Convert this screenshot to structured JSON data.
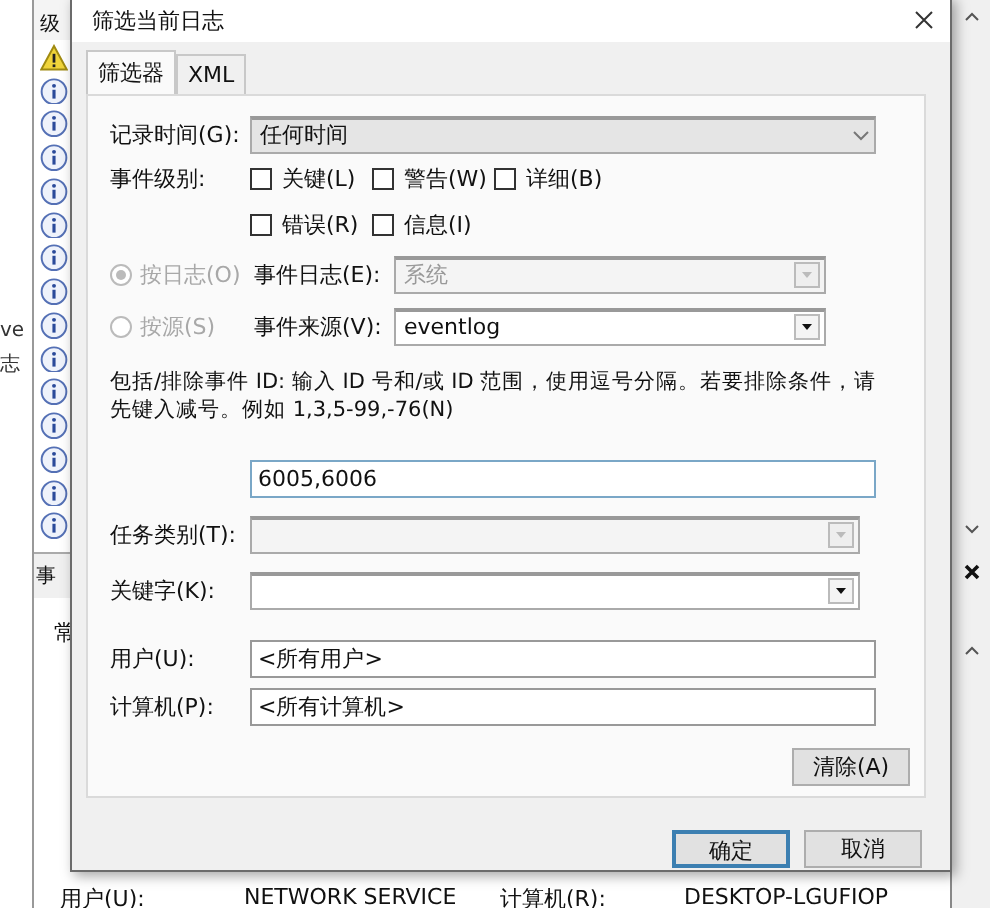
{
  "background_window": {
    "list_header": "级",
    "list_rows": [
      {
        "kind": "warning"
      },
      {
        "kind": "info"
      },
      {
        "kind": "info"
      },
      {
        "kind": "info"
      },
      {
        "kind": "info"
      },
      {
        "kind": "info"
      },
      {
        "kind": "info"
      },
      {
        "kind": "info"
      },
      {
        "kind": "info"
      },
      {
        "kind": "info"
      },
      {
        "kind": "info"
      },
      {
        "kind": "info"
      },
      {
        "kind": "info"
      },
      {
        "kind": "info"
      },
      {
        "kind": "info"
      }
    ],
    "side_texts": [
      "ve",
      "志"
    ],
    "details_tab": "事",
    "details_subtab": "常",
    "details_fields": [
      {
        "label": "用户(U):",
        "value": "NETWORK SERVICE"
      },
      {
        "label": "计算机(R):",
        "value": "DESKTOP-LGUFIOP"
      }
    ]
  },
  "dialog": {
    "title": "筛选当前日志",
    "tabs": [
      {
        "label": "筛选器",
        "selected": true
      },
      {
        "label": "XML",
        "selected": false
      }
    ],
    "logged": {
      "label": "记录时间(G):",
      "value": "任何时间"
    },
    "event_level": {
      "label": "事件级别:",
      "options": [
        {
          "label": "关键(L)",
          "checked": false
        },
        {
          "label": "警告(W)",
          "checked": false
        },
        {
          "label": "详细(B)",
          "checked": false
        },
        {
          "label": "错误(R)",
          "checked": false
        },
        {
          "label": "信息(I)",
          "checked": false
        }
      ]
    },
    "sources": [
      {
        "label": "按日志(O)",
        "selected": true,
        "disabled": true,
        "field_label": "事件日志(E):",
        "value": "系统",
        "field_disabled": true
      },
      {
        "label": "按源(S)",
        "selected": false,
        "disabled": true,
        "field_label": "事件来源(V):",
        "value": "eventlog",
        "field_disabled": false
      }
    ],
    "id_help": "包括/排除事件 ID: 输入 ID 号和/或 ID 范围，使用逗号分隔。若要排除条件，请先键入减号。例如 1,3,5-99,-76(N)",
    "id_value": "6005,6006",
    "task_category": {
      "label": "任务类别(T):",
      "disabled": true
    },
    "keywords": {
      "label": "关键字(K):",
      "disabled": false
    },
    "user": {
      "label": "用户(U):",
      "value": "<所有用户>"
    },
    "computer": {
      "label": "计算机(P):",
      "value": "<所有计算机>"
    },
    "clear_button": "清除(A)",
    "buttons": [
      {
        "label": "确定",
        "focused": true
      },
      {
        "label": "取消",
        "focused": false
      }
    ]
  }
}
